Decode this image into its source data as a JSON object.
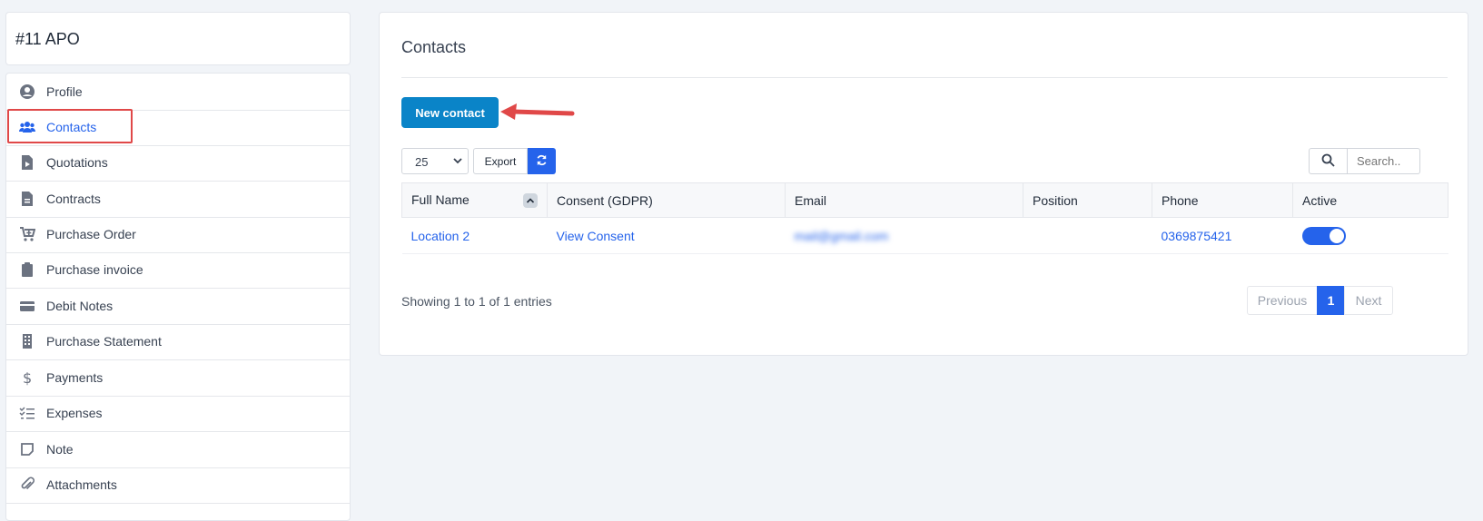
{
  "vendor": {
    "title": "#11 APO"
  },
  "sidebar": {
    "items": [
      {
        "label": "Profile",
        "icon": "user-circle-icon",
        "active": false
      },
      {
        "label": "Contacts",
        "icon": "users-icon",
        "active": true
      },
      {
        "label": "Quotations",
        "icon": "document-play-icon",
        "active": false
      },
      {
        "label": "Contracts",
        "icon": "document-icon",
        "active": false
      },
      {
        "label": "Purchase Order",
        "icon": "cart-plus-icon",
        "active": false
      },
      {
        "label": "Purchase invoice",
        "icon": "clipboard-icon",
        "active": false
      },
      {
        "label": "Debit Notes",
        "icon": "credit-card-icon",
        "active": false
      },
      {
        "label": "Purchase Statement",
        "icon": "building-icon",
        "active": false
      },
      {
        "label": "Payments",
        "icon": "dollar-icon",
        "active": false
      },
      {
        "label": "Expenses",
        "icon": "checklist-icon",
        "active": false
      },
      {
        "label": "Note",
        "icon": "sticky-note-icon",
        "active": false
      },
      {
        "label": "Attachments",
        "icon": "paperclip-icon",
        "active": false
      }
    ]
  },
  "main": {
    "title": "Contacts",
    "new_contact_label": "New contact",
    "page_size": "25",
    "export_label": "Export",
    "search_placeholder": "Search..",
    "table": {
      "columns": [
        "Full Name",
        "Consent (GDPR)",
        "Email",
        "Position",
        "Phone",
        "Active"
      ],
      "rows": [
        {
          "full_name": "Location 2",
          "consent": "View Consent",
          "email": "mail@gmail.com",
          "position": "",
          "phone": "0369875421",
          "active": true
        }
      ]
    },
    "showing_text": "Showing 1 to 1 of 1 entries",
    "pagination": {
      "previous": "Previous",
      "current": "1",
      "next": "Next"
    }
  },
  "colors": {
    "accent": "#2563eb",
    "primary_button": "#0a84c8",
    "highlight": "#e04848"
  }
}
